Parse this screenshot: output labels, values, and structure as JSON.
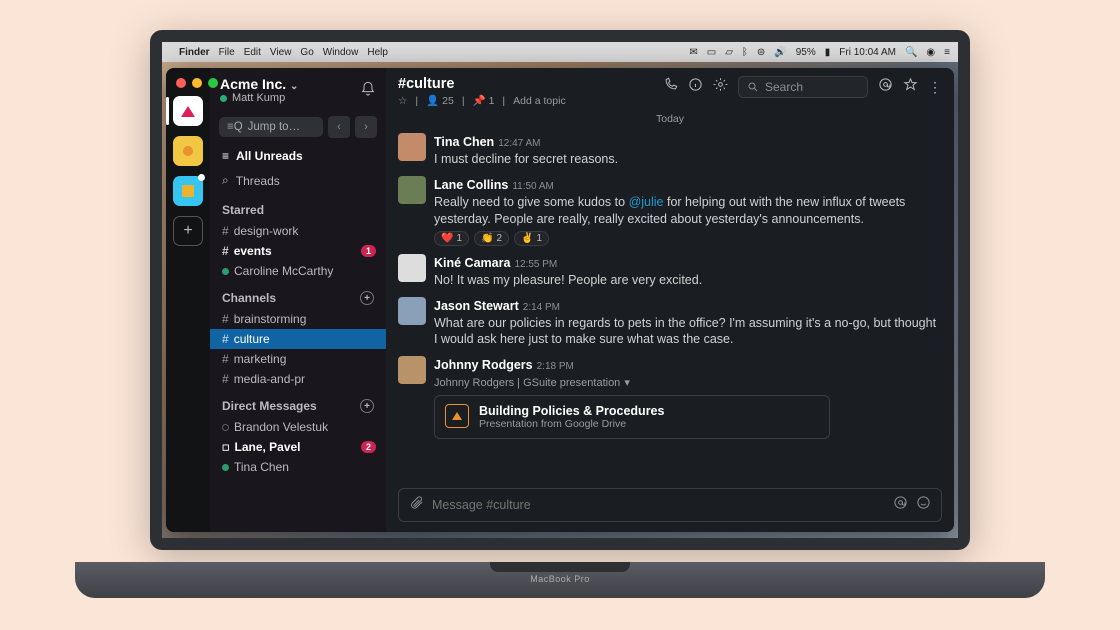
{
  "menubar": {
    "app": "Finder",
    "items": [
      "File",
      "Edit",
      "View",
      "Go",
      "Window",
      "Help"
    ],
    "battery": "95%",
    "clock": "Fri 10:04 AM"
  },
  "laptop": {
    "label": "MacBook Pro"
  },
  "workspace": {
    "name": "Acme Inc.",
    "user": "Matt Kump"
  },
  "sidebar": {
    "jump_to": "Jump to…",
    "all_unreads": "All Unreads",
    "threads": "Threads",
    "starred_heading": "Starred",
    "starred": [
      {
        "label": "design-work",
        "type": "channel"
      },
      {
        "label": "events",
        "type": "channel",
        "bold": true,
        "badge": "1"
      },
      {
        "label": "Caroline McCarthy",
        "type": "dm",
        "presence": "on"
      }
    ],
    "channels_heading": "Channels",
    "channels": [
      {
        "label": "brainstorming"
      },
      {
        "label": "culture",
        "active": true
      },
      {
        "label": "marketing"
      },
      {
        "label": "media-and-pr"
      }
    ],
    "dm_heading": "Direct Messages",
    "dms": [
      {
        "label": "Brandon Velestuk",
        "presence": "off"
      },
      {
        "label": "Lane, Pavel",
        "presence": "multi",
        "bold": true,
        "badge": "2"
      },
      {
        "label": "Tina Chen",
        "presence": "on"
      }
    ]
  },
  "channel": {
    "name": "#culture",
    "members": "25",
    "pins": "1",
    "topic_prompt": "Add a topic",
    "today": "Today",
    "search_placeholder": "Search",
    "compose_placeholder": "Message #culture"
  },
  "messages": {
    "m0": {
      "author": "Tina Chen",
      "time": "12:47 AM",
      "text": "I must decline for secret reasons.",
      "avatar": "#c48b6a"
    },
    "m1": {
      "author": "Lane Collins",
      "time": "11:50 AM",
      "text_pre": "Really need to give some kudos to ",
      "mention": "@julie",
      "text_post": " for helping out with the new influx of tweets yesterday. People are really, really excited about yesterday's announcements.",
      "avatar": "#6b7d55",
      "reactions": [
        {
          "emoji": "❤️",
          "count": "1"
        },
        {
          "emoji": "👏",
          "count": "2"
        },
        {
          "emoji": "✌️",
          "count": "1"
        }
      ]
    },
    "m2": {
      "author": "Kiné Camara",
      "time": "12:55 PM",
      "text": "No! It was my pleasure! People are very excited.",
      "avatar": "#ddd"
    },
    "m3": {
      "author": "Jason Stewart",
      "time": "2:14 PM",
      "text": "What are our policies in regards to pets in the office? I'm assuming it's a no-go, but thought I would ask here just to make sure what was the case.",
      "avatar": "#8aa0b8"
    },
    "m4": {
      "author": "Johnny Rodgers",
      "time": "2:18 PM",
      "share_line": "Johnny Rodgers | GSuite presentation",
      "file_title": "Building Policies & Procedures",
      "file_sub": "Presentation from Google Drive",
      "avatar": "#b89268"
    }
  }
}
